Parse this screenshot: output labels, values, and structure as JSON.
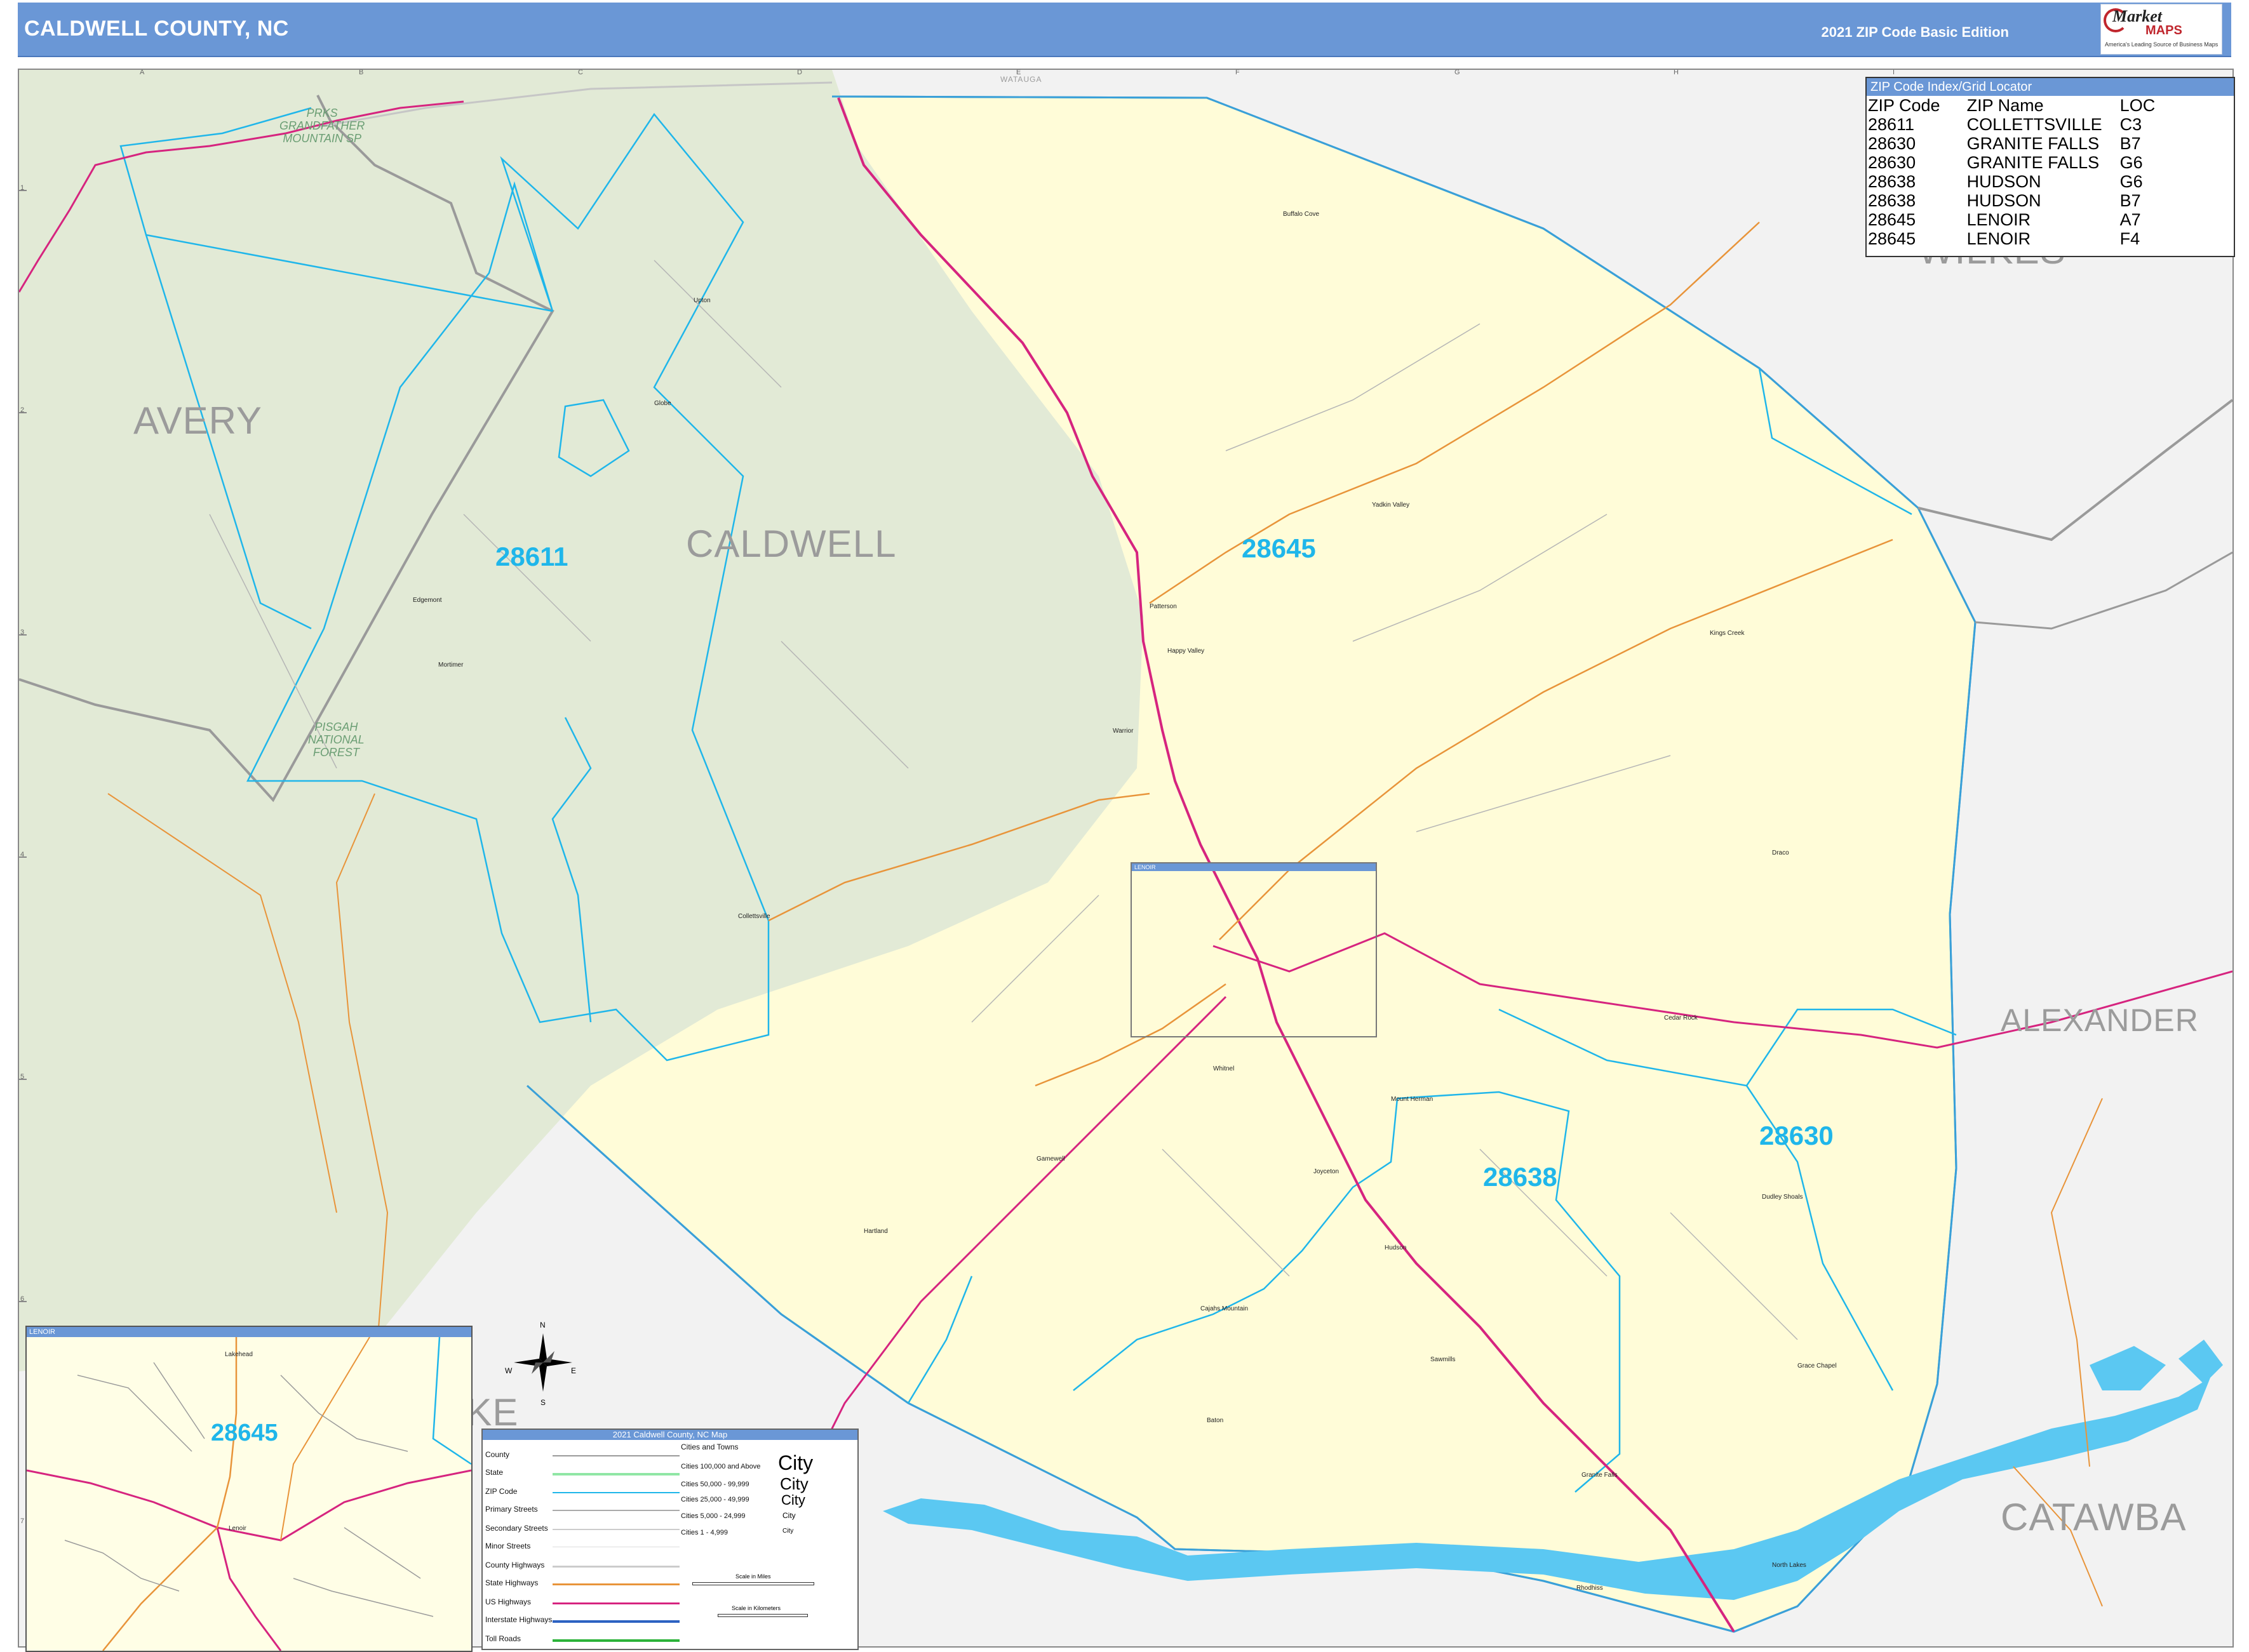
{
  "header": {
    "title": "CALDWELL COUNTY, NC",
    "edition": "2021 ZIP Code Basic Edition",
    "logo_text_1": "Market",
    "logo_text_2": "MAPS",
    "logo_tagline": "America's Leading Source of Business Maps"
  },
  "colors": {
    "header_bg": "#6a97d6",
    "caldwell_fill": "#fffcd8",
    "forest_fill": "#e2ead6",
    "outside_fill": "#f2f2f2",
    "zip_boundary": "#1fb6ea",
    "county_boundary": "#9a9a9a",
    "us_highway": "#d6247f",
    "state_highway": "#e8943a",
    "water": "#5bc8f2"
  },
  "grid": {
    "columns": [
      "A",
      "B",
      "C",
      "D",
      "E",
      "F",
      "G",
      "H",
      "I"
    ],
    "rows": [
      "1",
      "2",
      "3",
      "4",
      "5",
      "6",
      "7"
    ]
  },
  "counties": {
    "caldwell": "CALDWELL",
    "avery": "AVERY",
    "wilkes": "WILKES",
    "alexander": "ALEXANDER",
    "catawba": "CATAWBA",
    "watauga": "WATAUGA",
    "burke_partial": "RKE"
  },
  "zip_labels": {
    "z28611": "28611",
    "z28645": "28645",
    "z28638": "28638",
    "z28630": "28630",
    "inset_28645": "28645"
  },
  "parks": {
    "grandfather": "PRKS\nGRANDFATHER\nMOUNTAIN SP",
    "pisgah": "PISGAH\nNATIONAL\nFOREST"
  },
  "towns": [
    "Buffalo Cove",
    "Upton",
    "Globe",
    "Yadkin Valley",
    "Patterson",
    "Happy Valley",
    "Edgemont",
    "Mortimer",
    "Kings Creek",
    "Warrior",
    "Draco",
    "Collettsville",
    "Cedar Rock",
    "Whitnel",
    "Mount Herman",
    "Gamewell",
    "Joyceton",
    "Dudley Shoals",
    "Hartland",
    "Hudson",
    "Cajahs Mountain",
    "Sawmills",
    "Grace Chapel",
    "Baton",
    "Granite Falls",
    "North Lakes",
    "Rhodhiss"
  ],
  "zip_index": {
    "title": "ZIP Code Index/Grid Locator",
    "columns": [
      "ZIP Code",
      "ZIP Name",
      "LOC"
    ],
    "rows": [
      [
        "28611",
        "COLLETTSVILLE",
        "C3"
      ],
      [
        "28630",
        "GRANITE FALLS",
        "B7"
      ],
      [
        "28630",
        "GRANITE FALLS",
        "G6"
      ],
      [
        "28638",
        "HUDSON",
        "G6"
      ],
      [
        "28638",
        "HUDSON",
        "B7"
      ],
      [
        "28645",
        "LENOIR",
        "A7"
      ],
      [
        "28645",
        "LENOIR",
        "F4"
      ]
    ]
  },
  "inset_top": {
    "title": "LENOIR"
  },
  "inset_lenoir": {
    "title": "LENOIR",
    "town": "Lenoir",
    "town2": "Lakehead"
  },
  "compass": {
    "n": "N",
    "s": "S",
    "e": "E",
    "w": "W"
  },
  "legend": {
    "title": "2021 Caldwell County, NC Map",
    "items": [
      "County",
      "State",
      "ZIP Code",
      "Primary Streets",
      "Secondary Streets",
      "Minor Streets",
      "County Highways",
      "State Highways",
      "US Highways",
      "Interstate Highways",
      "Toll Roads"
    ],
    "cities_header": "Cities and Towns",
    "city_classes": [
      "Cities 100,000 and Above",
      "Cities 50,000 - 99,999",
      "Cities 25,000 - 49,999",
      "Cities 5,000 - 24,999",
      "Cities 1 - 4,999"
    ],
    "city_glyphs": [
      "City",
      "City",
      "City",
      "City",
      "City"
    ],
    "scale_miles": "Scale in Miles",
    "scale_km": "Scale in Kilometers"
  }
}
